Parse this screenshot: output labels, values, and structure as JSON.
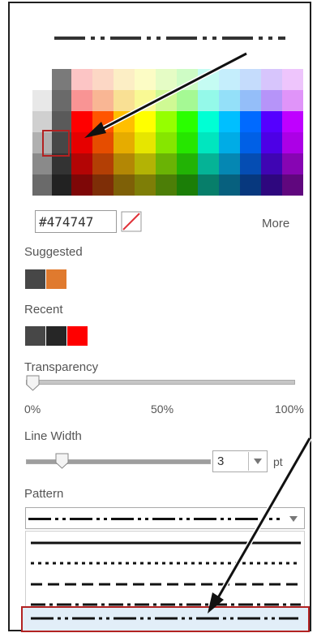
{
  "color": {
    "hex_value": "#474747",
    "more_label": "More"
  },
  "sections": {
    "suggested": "Suggested",
    "recent": "Recent",
    "transparency": "Transparency",
    "line_width": "Line Width",
    "pattern": "Pattern"
  },
  "suggested_swatches": [
    "#474747",
    "#e07a2e"
  ],
  "recent_swatches": [
    "#474747",
    "#262626",
    "#ff0000"
  ],
  "transparency": {
    "value": 0.0,
    "ticks": [
      "0%",
      "50%",
      "100%"
    ]
  },
  "line_width": {
    "value": "3",
    "unit": "pt",
    "slider_fraction": 0.3
  },
  "pattern": {
    "selected": "dash-dot-dot",
    "options": [
      "solid",
      "dot",
      "dash",
      "dash-dot",
      "dash-dot-dot"
    ]
  },
  "colors": {
    "selection_highlight": "#b22222",
    "selected_option_bg": "#e2eef8"
  }
}
